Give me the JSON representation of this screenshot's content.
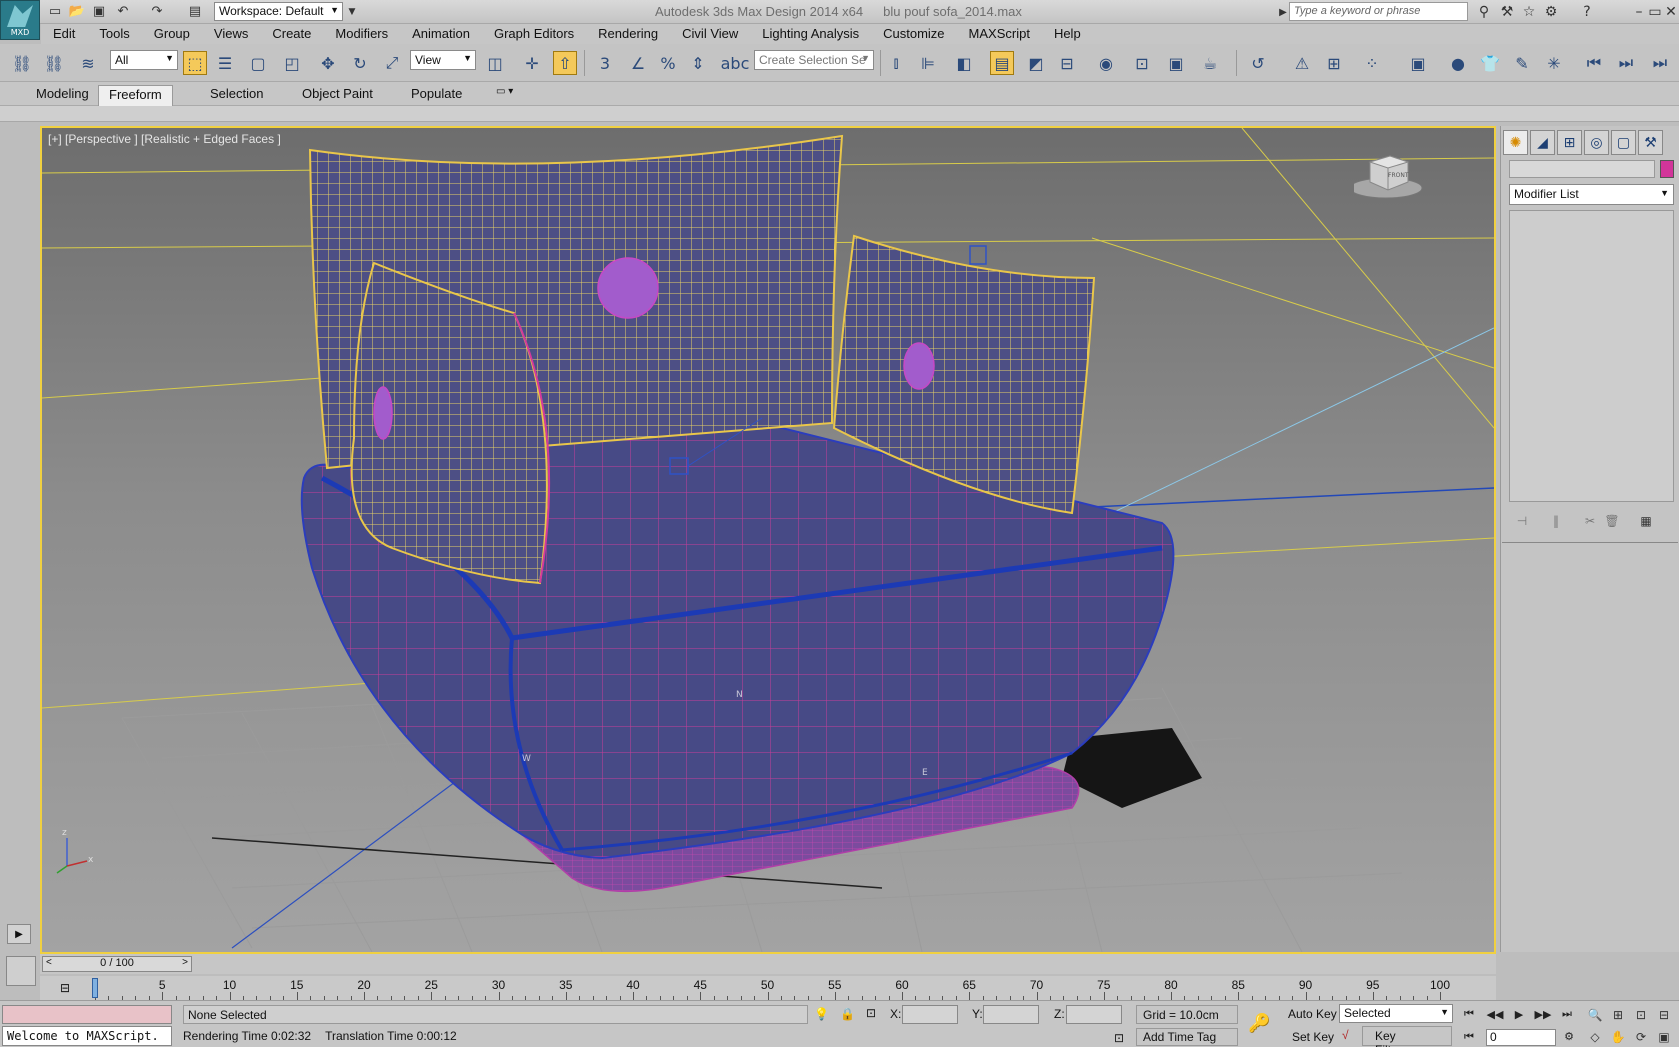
{
  "app": {
    "title": "Autodesk 3ds Max Design 2014 x64",
    "file": "blu pouf sofa_2014.max",
    "logo_text": "MXD",
    "workspace": "Workspace: Default",
    "search_placeholder": "Type a keyword or phrase"
  },
  "menu": [
    "Edit",
    "Tools",
    "Group",
    "Views",
    "Create",
    "Modifiers",
    "Animation",
    "Graph Editors",
    "Rendering",
    "Civil View",
    "Lighting Analysis",
    "Customize",
    "MAXScript",
    "Help"
  ],
  "toolbar": {
    "filter": "All",
    "ref_coord": "View",
    "selection_set_placeholder": "Create Selection Se"
  },
  "ribbon": {
    "tabs": [
      "Modeling",
      "Freeform",
      "Selection",
      "Object Paint",
      "Populate"
    ],
    "active_tab": "Freeform"
  },
  "viewport": {
    "label": "[+] [Perspective ] [Realistic + Edged Faces ]",
    "viewcube_label": "FRONT",
    "axis": {
      "z": "z",
      "y": "y",
      "x": "x"
    },
    "markers": {
      "n": "N",
      "w": "W",
      "e": "E"
    }
  },
  "command_panel": {
    "modifier_list": "Modifier List",
    "object_color": "#d2359a"
  },
  "time_slider": {
    "position_text": "0 / 100",
    "current": 0,
    "total": 100,
    "ticks": [
      "0",
      "5",
      "10",
      "15",
      "20",
      "25",
      "30",
      "35",
      "40",
      "45",
      "50",
      "55",
      "60",
      "65",
      "70",
      "75",
      "80",
      "85",
      "90",
      "95",
      "100"
    ]
  },
  "status": {
    "maxscript_output": "",
    "maxscript_input": "Welcome to MAXScript.",
    "selection": "None Selected",
    "rendering_time": "Rendering Time  0:02:32",
    "translation_time": "Translation Time  0:00:12",
    "x_label": "X:",
    "y_label": "Y:",
    "z_label": "Z:",
    "grid": "Grid = 10.0cm",
    "add_time_tag": "Add Time Tag",
    "auto_key": "Auto Key",
    "set_key": "Set Key",
    "key_mode": "Selected",
    "key_filters": "Key Filters...",
    "frame": "0"
  },
  "colors": {
    "viewport_border": "#f0d040",
    "active_tool": "#f4c95a",
    "sofa_fabric": "#4a4c86",
    "wire_selected_yellow": "#e8d46a",
    "wire_magenta": "#d23a9c"
  }
}
